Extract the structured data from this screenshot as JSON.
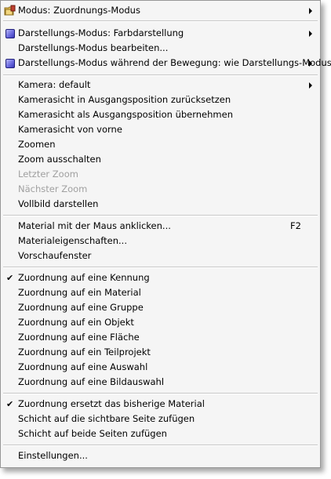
{
  "menu": {
    "modus": "Modus:  Zuordnungs-Modus",
    "darstellungs_modus": "Darstellungs-Modus: Farbdarstellung",
    "darstellungs_bearbeiten": "Darstellungs-Modus bearbeiten...",
    "darstellungs_bewegung": "Darstellungs-Modus während der Bewegung: wie Darstellungs-Modus",
    "kamera": "Kamera: default",
    "kamera_reset": "Kamerasicht in Ausgangsposition zurücksetzen",
    "kamera_uebernehmen": "Kamerasicht als Ausgangsposition übernehmen",
    "kamera_vorne": "Kamerasicht von vorne",
    "zoomen": "Zoomen",
    "zoom_aus": "Zoom ausschalten",
    "letzter_zoom": "Letzter Zoom",
    "naechster_zoom": "Nächster Zoom",
    "vollbild": "Vollbild darstellen",
    "material_maus": "Material mit der Maus anklicken...",
    "material_maus_shortcut": "F2",
    "materialeigenschaften": "Materialeigenschaften...",
    "vorschaufenster": "Vorschaufenster",
    "zuordnung_kennung": "Zuordnung auf eine Kennung",
    "zuordnung_material": "Zuordnung auf ein Material",
    "zuordnung_gruppe": "Zuordnung auf eine Gruppe",
    "zuordnung_objekt": "Zuordnung auf ein Objekt",
    "zuordnung_flaeche": "Zuordnung auf eine Fläche",
    "zuordnung_teilprojekt": "Zuordnung auf ein Teilprojekt",
    "zuordnung_auswahl": "Zuordnung auf eine Auswahl",
    "zuordnung_bildauswahl": "Zuordnung auf eine Bildauswahl",
    "ersetzt_material": "Zuordnung ersetzt das bisherige Material",
    "schicht_sichtbar": "Schicht auf die sichtbare Seite zufügen",
    "schicht_beide": "Schicht auf beide Seiten zufügen",
    "einstellungen": "Einstellungen...",
    "check_glyph": "✔"
  },
  "icons": {
    "modus": "folder-paint-icon",
    "darstellung": "blue-cube-icon"
  }
}
